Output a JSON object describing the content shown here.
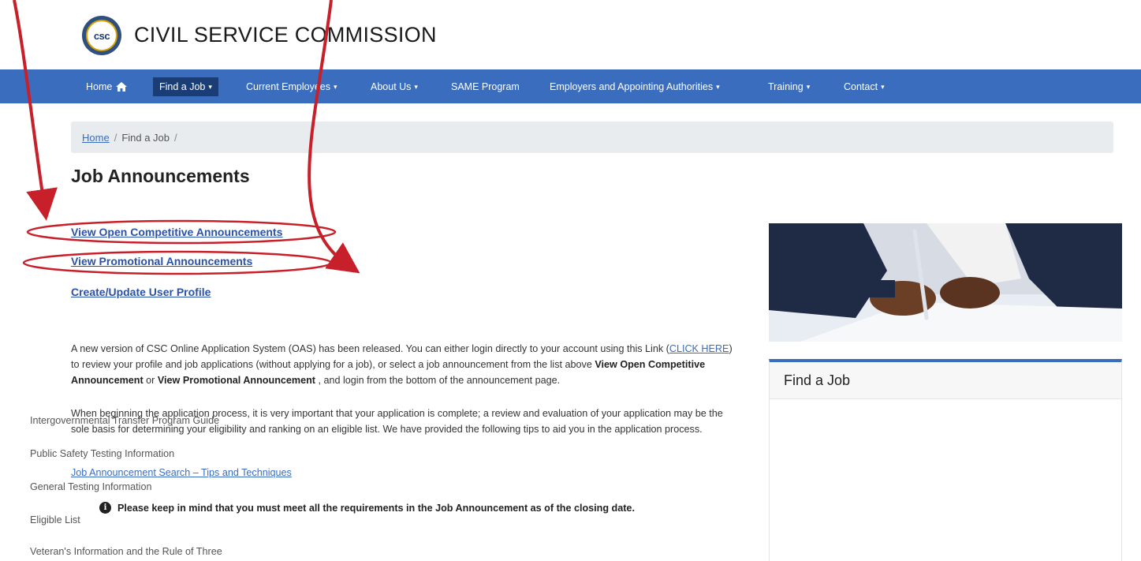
{
  "header": {
    "logo_text": "csc",
    "site_title": "CIVIL SERVICE COMMISSION"
  },
  "nav": {
    "items": [
      {
        "label": "Home",
        "icon": "home-icon"
      },
      {
        "label": "Find a Job"
      },
      {
        "label": "Current Employees"
      },
      {
        "label": "About Us"
      },
      {
        "label": "SAME Program"
      },
      {
        "label": "Employers and Appointing Authorities"
      },
      {
        "label": "Training"
      },
      {
        "label": "Contact"
      }
    ],
    "active": "Find a Job"
  },
  "breadcrumb": {
    "home": "Home",
    "current": "Find a Job",
    "separator": "/"
  },
  "main": {
    "title": "Job Announcements",
    "links": [
      "View Open Competitive Announcements",
      "View Promotional Announcements",
      "Create/Update User Profile"
    ],
    "para1": {
      "part1": "A new version of CSC Online Application System (OAS) has been released. You can either login directly to your account using this Link (",
      "link": "CLICK HERE",
      "part2": ") to review your profile and job applications (without applying for a job), or select a job announcement from the list above ",
      "bold1": "View Open Competitive Announcement",
      "part3": " or ",
      "bold2": "View Promotional Announcement",
      "part4": " , and login from the bottom of the announcement page."
    },
    "para2": "When beginning the application process, it is very important that your application is complete; a review and evaluation of your application may be the sole basis for determining your eligibility and ranking on an eligible list. We have provided the following tips to aid you in the application process.",
    "tips_link": "Job Announcement Search – Tips and Techniques",
    "notice": "Please keep in mind that you must meet all the requirements in the Job Announcement as of the closing date."
  },
  "sidebar": {
    "title": "Find a Job",
    "links": [
      "Intergovernmental Transfer Program Guide",
      "Public Safety Testing Information",
      "General Testing Information",
      "Eligible List",
      "Veteran's Information and the Rule of Three"
    ]
  },
  "colors": {
    "nav_bg": "#3a6dbd",
    "nav_active": "#1b3d75",
    "annotation": "#c8202a",
    "link": "#2a52a8"
  }
}
